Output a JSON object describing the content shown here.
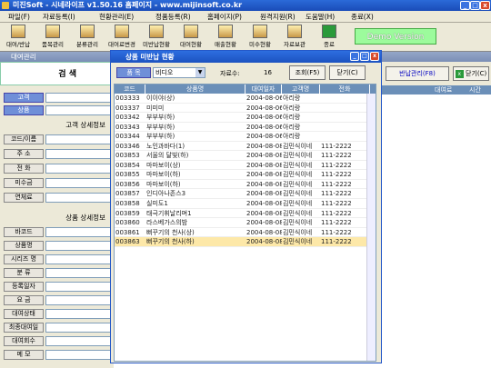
{
  "window": {
    "title": "미진Soft - 시네라이프 v1.50.16 홈페이지 - www.mijinsoft.co.kr"
  },
  "menu": [
    "파일(F)",
    "자료등록(I)",
    "현황관리(E)",
    "정품등록(R)",
    "홈페이지(P)",
    "원격지원(R)",
    "도움말(H)",
    "종료(X)"
  ],
  "toolbar": [
    "대여/반납",
    "품목관리",
    "분류관리",
    "대여료변경",
    "미반납현황",
    "대여현황",
    "매출현황",
    "미수현황",
    "자료보관",
    "종료"
  ],
  "demo_label": "Demo Version",
  "child_title": "대여관리",
  "left": {
    "search_title": "검    색",
    "btn_customer": "고객",
    "btn_product": "상품",
    "sec_customer": "고객 상세정보",
    "customer_fields": [
      "코드/이름",
      "주  소",
      "전  화",
      "미수금",
      "연체료"
    ],
    "sec_product": "상품 상세정보",
    "product_fields": [
      "바코드",
      "상품명",
      "시리즈 명",
      "분  류",
      "등록일자",
      "요  금",
      "대여상태",
      "최종대여일",
      "대여회수",
      "메  모"
    ]
  },
  "right": {
    "btn_return": "반납관리(F8)",
    "btn_close": "닫기(C)",
    "col_rent": "대여료",
    "col_time": "시간"
  },
  "popup": {
    "title": "상품 미반납 현황",
    "category_label": "품  목",
    "category_value": "비디오",
    "count_label": "자료수:",
    "count_value": "16",
    "btn_search": "조회(F5)",
    "btn_close": "닫기(C)",
    "columns": [
      "코드",
      "상품명",
      "대여일자",
      "고객명",
      "전화"
    ],
    "rows": [
      [
        "003333",
        "이이야(상)",
        "2004-08-06",
        "아리랑",
        ""
      ],
      [
        "003337",
        "미미미",
        "2004-08-06",
        "아리랑",
        ""
      ],
      [
        "003342",
        "부부부(하)",
        "2004-08-06",
        "아리랑",
        ""
      ],
      [
        "003343",
        "부부부(하)",
        "2004-08-06",
        "아리랑",
        ""
      ],
      [
        "003344",
        "부부부(하)",
        "2004-08-06",
        "아리랑",
        ""
      ],
      [
        "003346",
        "노인과바다(1)",
        "2004-08-08",
        "김민식이네",
        "111-2222"
      ],
      [
        "003853",
        "서울의 달빛(하)",
        "2004-08-08",
        "김민식이네",
        "111-2222"
      ],
      [
        "003854",
        "마마보이(상)",
        "2004-08-08",
        "김민식이네",
        "111-2222"
      ],
      [
        "003855",
        "마마보이(하)",
        "2004-08-08",
        "김민식이네",
        "111-2222"
      ],
      [
        "003856",
        "마마보이(하)",
        "2004-08-08",
        "김민식이네",
        "111-2222"
      ],
      [
        "003857",
        "인디아나존스3",
        "2004-08-08",
        "김민식이네",
        "111-2222"
      ],
      [
        "003858",
        "실미도1",
        "2004-08-08",
        "김민식이네",
        "111-2222"
      ],
      [
        "003859",
        "태극기휘날리며1",
        "2004-08-08",
        "김민식이네",
        "111-2222"
      ],
      [
        "003860",
        "라스베가스의밤",
        "2004-08-08",
        "김민식이네",
        "111-2222"
      ],
      [
        "003861",
        "뻐꾸기의 천사(상)",
        "2004-08-08",
        "김민식이네",
        "111-2222"
      ],
      [
        "003863",
        "뻐꾸기의 천사(하)",
        "2004-08-08",
        "김민식이네",
        "111-2222"
      ]
    ]
  }
}
